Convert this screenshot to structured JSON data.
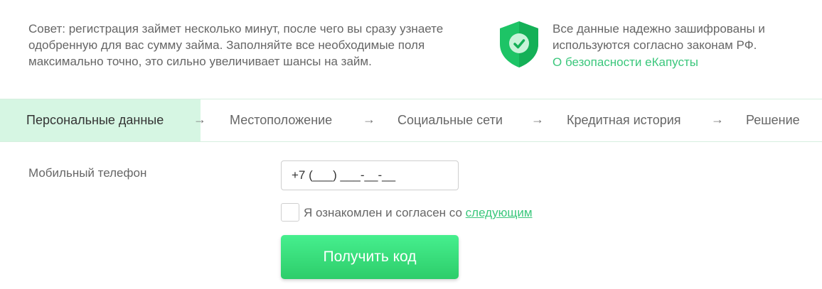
{
  "tip": {
    "text": "Совет: регистрация займет несколько минут, после чего вы сразу узнаете одобренную для вас сумму займа. Заполняйте все необходимые поля максимально точно, это сильно увеличивает шансы на займ."
  },
  "security": {
    "icon": "shield-check-icon",
    "line1": "Все данные надежно зашифрованы и",
    "line2": "используются согласно законам РФ.",
    "link": "О безопасности еКапусты",
    "colors": {
      "shield": "#1dc466",
      "link": "#3bc77c"
    }
  },
  "steps": {
    "items": [
      {
        "label": "Персональные данные",
        "active": true
      },
      {
        "label": "Местоположение"
      },
      {
        "label": "Социальные сети"
      },
      {
        "label": "Кредитная история"
      },
      {
        "label": "Решение"
      }
    ],
    "arrow": "→"
  },
  "form": {
    "phone_label": "Мобильный телефон",
    "phone_value": "+7 (___) ___-__-__",
    "agree_text": "Я ознакомлен и согласен со",
    "agree_link": "следующим",
    "submit_label": "Получить код"
  }
}
